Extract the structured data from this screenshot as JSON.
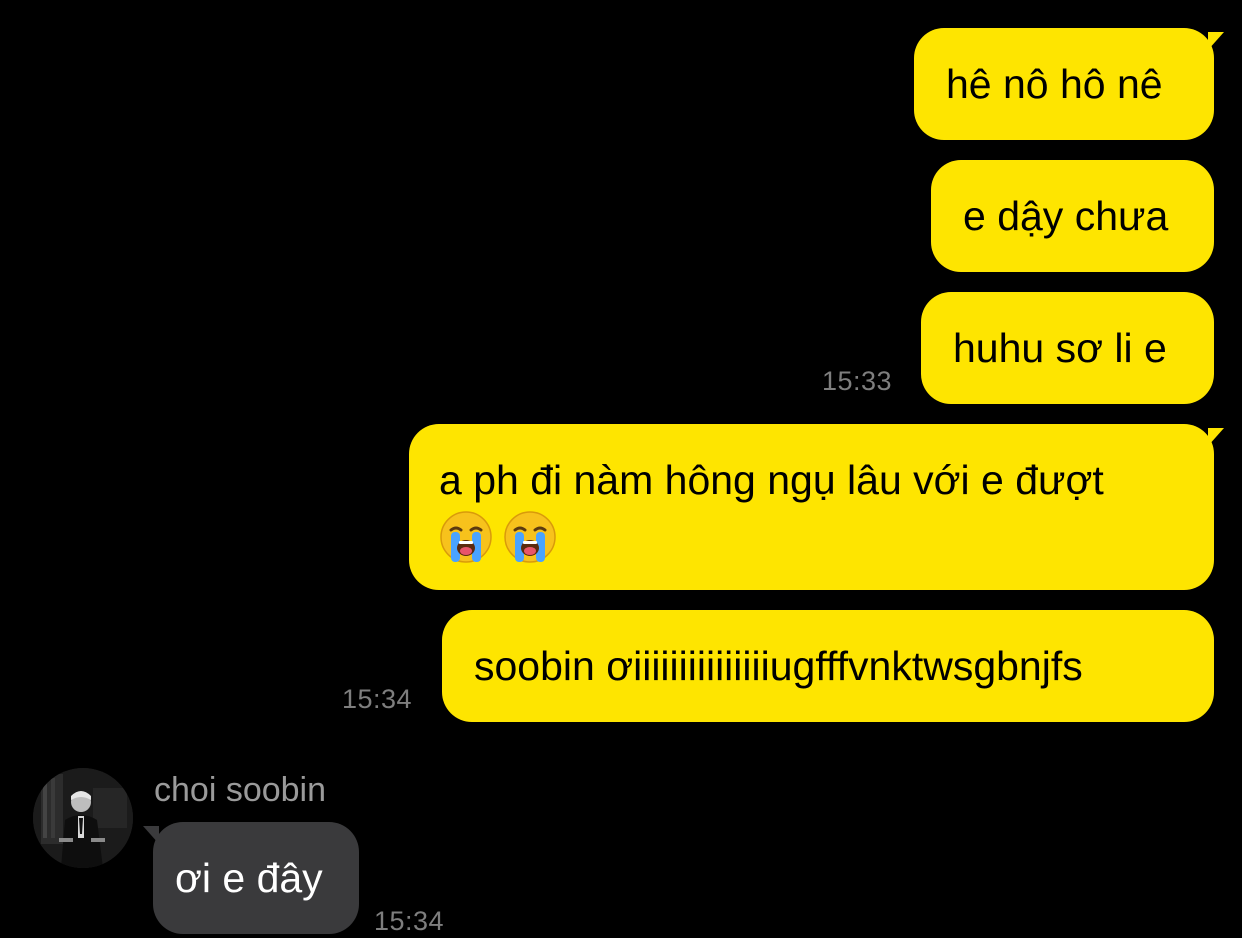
{
  "conversation": {
    "messages_out": [
      {
        "text": "hê nô hô nê"
      },
      {
        "text": "e dậy chưa"
      },
      {
        "text": "huhu sơ li e"
      },
      {
        "text": "a ph đi nàm hông ngụ lâu với e đượt"
      },
      {
        "text": "soobin ơiiiiiiiiiiiiiiiugfffvnktwsgbnjfs"
      }
    ],
    "times": {
      "group1": "15:33",
      "group2": "15:34",
      "incoming": "15:34"
    },
    "incoming": {
      "sender_name": "choi soobin",
      "text": "ơi e đây"
    },
    "emoji": {
      "icon": "loudly-crying-face-icon",
      "count": 2
    }
  },
  "colors": {
    "background": "#000000",
    "outgoing_bubble": "#fee500",
    "incoming_bubble": "#3a3a3c",
    "timestamp": "#7e7e7e"
  }
}
